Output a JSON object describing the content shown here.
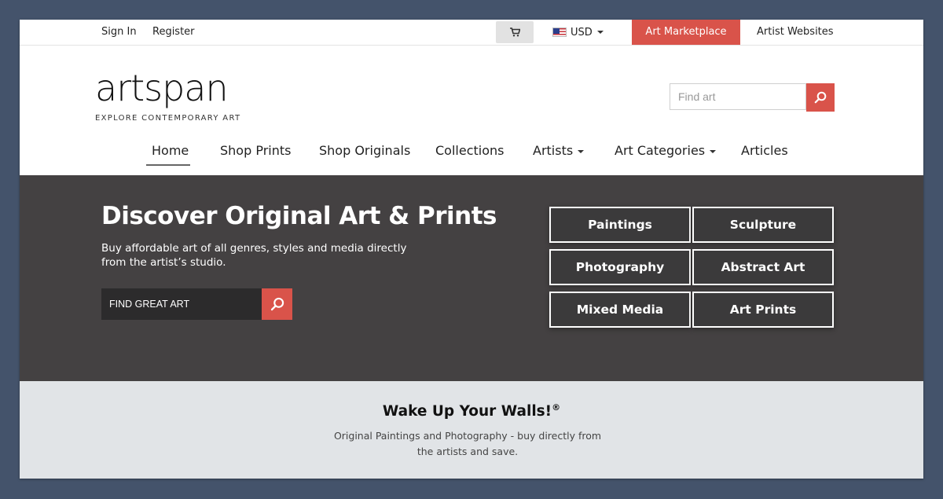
{
  "topbar": {
    "sign_in": "Sign In",
    "register": "Register",
    "cart_icon": "cart-icon",
    "currency": "USD",
    "marketplace": "Art Marketplace",
    "artist_websites": "Artist Websites"
  },
  "header": {
    "logo": "artspan",
    "tagline": "EXPLORE CONTEMPORARY ART",
    "search_placeholder": "Find art",
    "search_icon": "search-icon"
  },
  "nav": {
    "items": [
      {
        "label": "Home",
        "active": true
      },
      {
        "label": "Shop Prints"
      },
      {
        "label": "Shop Originals"
      },
      {
        "label": "Collections"
      },
      {
        "label": "Artists",
        "dropdown": true
      },
      {
        "label": "Art Categories",
        "dropdown": true
      },
      {
        "label": "Articles"
      }
    ]
  },
  "hero": {
    "title": "Discover Original Art & Prints",
    "subtitle": "Buy affordable art of all genres, styles and media directly from the artist’s studio.",
    "search_placeholder": "FIND GREAT ART",
    "categories": [
      "Paintings",
      "Sculpture",
      "Photography",
      "Abstract Art",
      "Mixed Media",
      "Art Prints"
    ]
  },
  "band": {
    "title": "Wake Up Your Walls!",
    "title_mark": "®",
    "text": "Original Paintings and Photography - buy directly from the artists and save."
  },
  "colors": {
    "background": "#44536b",
    "accent": "#d9534a",
    "hero_bg": "#444142",
    "band_bg": "#e1e4e7"
  }
}
